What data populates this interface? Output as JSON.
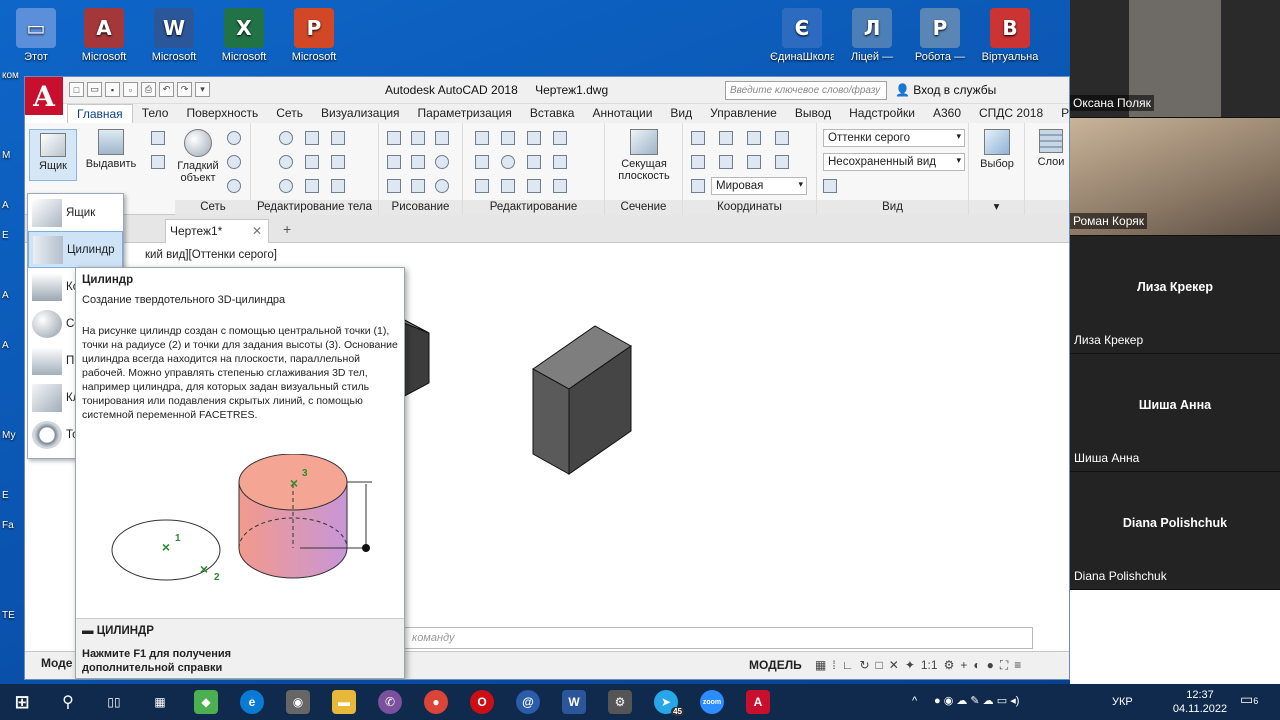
{
  "desktop": {
    "icons": [
      {
        "label": "Этот",
        "color": "#5b8fd9",
        "glyph": "▭",
        "icon": "computer-icon"
      },
      {
        "label": "Microsoft",
        "color": "#a4373a",
        "glyph": "A",
        "icon": "access-icon"
      },
      {
        "label": "Microsoft",
        "color": "#2b579a",
        "glyph": "W",
        "icon": "word-icon"
      },
      {
        "label": "Microsoft",
        "color": "#217346",
        "glyph": "X",
        "icon": "excel-icon"
      },
      {
        "label": "Microsoft",
        "color": "#d24726",
        "glyph": "P",
        "icon": "powerpoint-icon"
      },
      {
        "label": "ЄдинаШкола",
        "color": "#2c6bbf",
        "glyph": "Є",
        "icon": "school-icon"
      },
      {
        "label": "Ліцей —",
        "color": "#4c7fb8",
        "glyph": "Л",
        "icon": "people-icon"
      },
      {
        "label": "Робота —",
        "color": "#5a86b5",
        "glyph": "Р",
        "icon": "network-icon"
      },
      {
        "label": "Віртуальна",
        "color": "#c33",
        "glyph": "В",
        "icon": "magnet-icon"
      }
    ],
    "left_edge": [
      "ком",
      "М",
      "А",
      "Е",
      "А",
      "А",
      "Му",
      "Е",
      "Fa",
      "TE"
    ]
  },
  "acad": {
    "title": "Autodesk AutoCAD 2018",
    "doc": "Чертеж1.dwg",
    "search_placeholder": "Введите ключевое слово/фразу",
    "signin": "Вход в службы",
    "tabs": [
      "Главная",
      "Тело",
      "Поверхность",
      "Сеть",
      "Визуализация",
      "Параметризация",
      "Вставка",
      "Аннотации",
      "Вид",
      "Управление",
      "Вывод",
      "Надстройки",
      "A360",
      "СПДС 2018",
      "Рекомендова"
    ],
    "ribbon": {
      "box": "Ящик",
      "extrude": "Выдавить",
      "smooth": "Гладкий объект",
      "section_plane": "Секущая плоскость",
      "select": "Выбор",
      "layers": "Слои",
      "visual_style": "Оттенки серого",
      "view_saved": "Несохраненный вид",
      "ucs": "Мировая",
      "groups": [
        "Сеть",
        "Редактирование тела",
        "Рисование",
        "Редактирование",
        "Сечение",
        "Координаты",
        "Вид"
      ]
    },
    "flyout": [
      "Ящик",
      "Цилиндр",
      "Ко",
      "Сф",
      "Пи",
      "Кл",
      "То"
    ],
    "doc_tab": "Чертеж1*",
    "view_label": "кий вид][Оттенки серого]",
    "tooltip": {
      "title": "Цилиндр",
      "subtitle": "Создание твердотельного 3D-цилиндра",
      "body": "На рисунке цилиндр создан с помощью центральной точки (1), точки на радиусе (2) и точки для задания высоты (3). Основание цилиндра всегда находится на плоскости, параллельной рабочей. Можно управлять степенью сглаживания 3D тел, например цилиндра, для которых задан визуальный стиль тонирования или подавления скрытых линий, с помощью системной переменной FACETRES.",
      "cmd": "ЦИЛИНДР",
      "help": "Нажмите F1 для получения дополнительной справки",
      "pt1": "1",
      "pt2": "2",
      "pt3": "3"
    },
    "cmd_placeholder": "команду",
    "status": {
      "model_tab": "Моде",
      "model": "МОДЕЛЬ",
      "scale": "1:1"
    }
  },
  "participants": [
    {
      "name": "Оксана Поляк",
      "video": true
    },
    {
      "name": "Роман Коряк",
      "video": true
    },
    {
      "name": "Лиза Крекер",
      "video": false
    },
    {
      "name": "Шиша Анна",
      "video": false
    },
    {
      "name": "Diana Polishchuk",
      "video": false
    }
  ],
  "taskbar": {
    "lang": "УКР",
    "time": "12:37",
    "date": "04.11.2022",
    "notif": "6",
    "zoom": "zoom",
    "badge": "45"
  }
}
